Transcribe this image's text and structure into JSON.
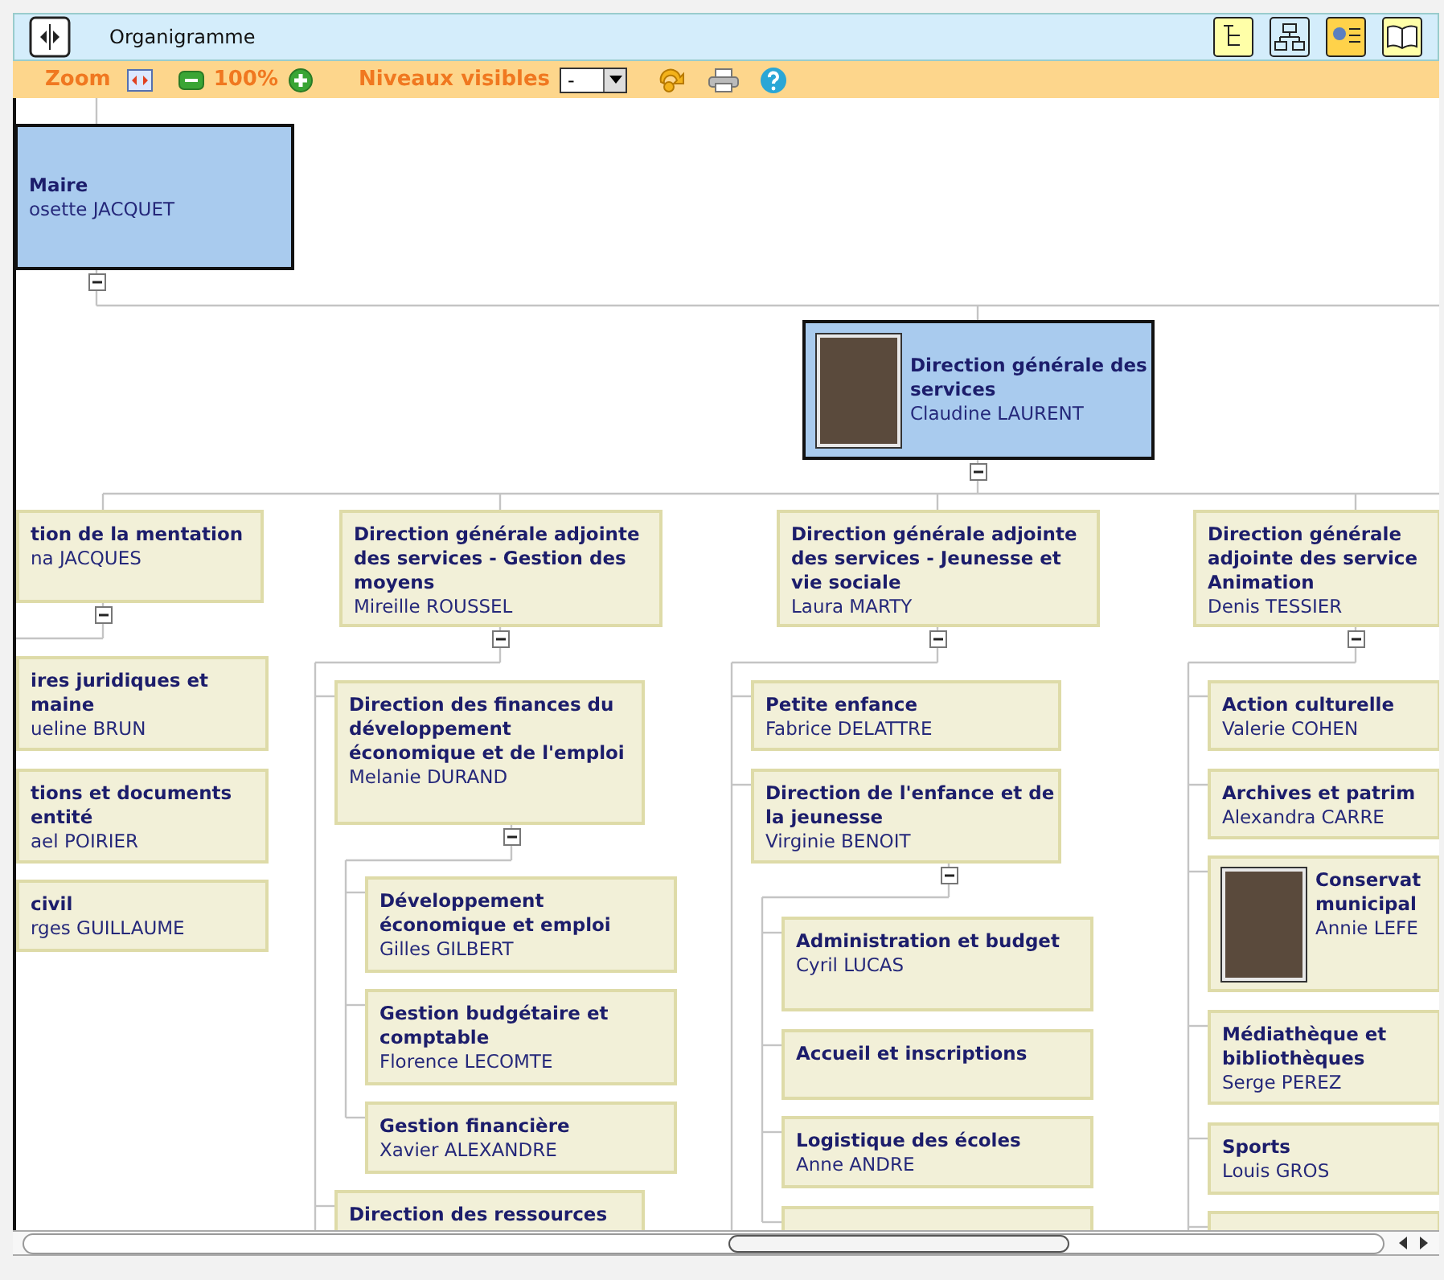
{
  "header": {
    "title": "Organigramme"
  },
  "toolbar": {
    "zoom_label": "Zoom",
    "zoom_value": "100%",
    "levels_label": "Niveaux visibles",
    "levels_select": {
      "value": "-"
    }
  },
  "chart": {
    "kind": "highlight",
    "title": "Maire",
    "name": "osette JACQUET",
    "expanded": true,
    "children": [
      {
        "kind": "highlight",
        "title": "Direction générale des services",
        "name": "Claudine LAURENT",
        "photo": true,
        "expanded": true,
        "children": [
          {
            "kind": "normal",
            "title": "tion de la mentation",
            "name": "na JACQUES",
            "expanded": true,
            "children": [
              {
                "kind": "normal",
                "title": "ires juridiques et maine",
                "name": "ueline BRUN"
              },
              {
                "kind": "normal",
                "title": "tions et documents entité",
                "name": "ael POIRIER"
              },
              {
                "kind": "normal",
                "title": "civil",
                "name": "rges GUILLAUME"
              }
            ]
          },
          {
            "kind": "normal",
            "title": "Direction générale adjointe des services - Gestion des moyens",
            "name": "Mireille ROUSSEL",
            "expanded": true,
            "children": [
              {
                "kind": "normal",
                "title": "Direction des finances du développement économique et de l'emploi",
                "name": "Melanie DURAND",
                "expanded": true,
                "children": [
                  {
                    "kind": "normal",
                    "title": "Développement économique et emploi",
                    "name": "Gilles GILBERT"
                  },
                  {
                    "kind": "normal",
                    "title": "Gestion budgétaire et comptable",
                    "name": "Florence LECOMTE"
                  },
                  {
                    "kind": "normal",
                    "title": "Gestion financière",
                    "name": "Xavier ALEXANDRE"
                  }
                ]
              },
              {
                "kind": "normal",
                "title": "Direction des ressources"
              }
            ]
          },
          {
            "kind": "normal",
            "title": "Direction générale adjointe des services - Jeunesse et vie sociale",
            "name": "Laura MARTY",
            "expanded": true,
            "children": [
              {
                "kind": "normal",
                "title": "Petite enfance",
                "name": "Fabrice DELATTRE"
              },
              {
                "kind": "normal",
                "title": "Direction de l'enfance et de la jeunesse",
                "name": "Virginie BENOIT",
                "expanded": true,
                "children": [
                  {
                    "kind": "normal",
                    "title": "Administration et budget",
                    "name": "Cyril LUCAS"
                  },
                  {
                    "kind": "normal",
                    "title": "Accueil et inscriptions"
                  },
                  {
                    "kind": "normal",
                    "title": "Logistique des écoles",
                    "name": "Anne ANDRE"
                  },
                  {
                    "kind": "normal"
                  }
                ]
              }
            ]
          },
          {
            "kind": "normal",
            "title": "Direction générale adjointe des service Animation",
            "name": "Denis TESSIER",
            "expanded": true,
            "children": [
              {
                "kind": "normal",
                "title": "Action culturelle",
                "name": "Valerie COHEN"
              },
              {
                "kind": "normal",
                "title": "Archives et patrim",
                "name": "Alexandra CARRE"
              },
              {
                "kind": "normal",
                "title": "Conservat municipal",
                "name": "Annie LEFE",
                "photo": true
              },
              {
                "kind": "normal",
                "title": "Médiathèque et bibliothèques",
                "name": "Serge PEREZ"
              },
              {
                "kind": "normal",
                "title": "Sports",
                "name": "Louis GROS"
              },
              {
                "kind": "normal"
              }
            ]
          }
        ]
      }
    ]
  }
}
